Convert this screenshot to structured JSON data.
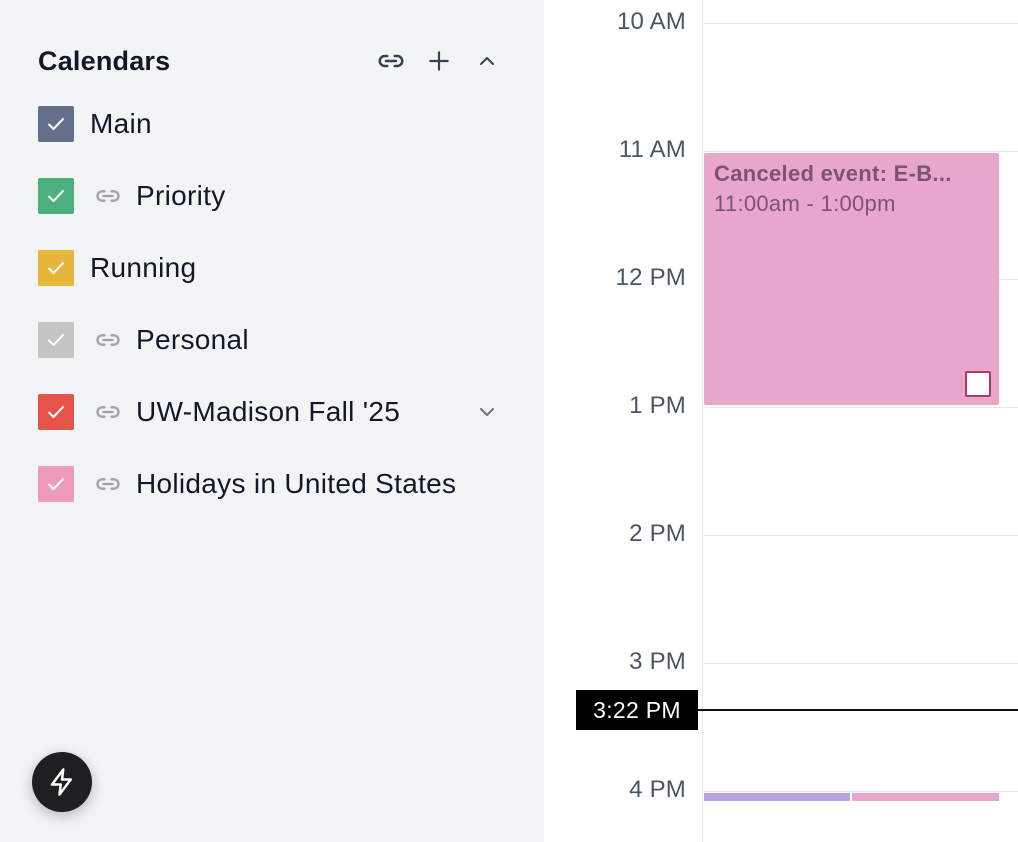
{
  "sidebar": {
    "title": "Calendars",
    "actions": [
      {
        "name": "link-calendar-button",
        "icon": "link-icon"
      },
      {
        "name": "add-calendar-button",
        "icon": "plus-icon"
      },
      {
        "name": "collapse-calendars-button",
        "icon": "chevron-up-icon"
      }
    ],
    "calendars": [
      {
        "label": "Main",
        "color": "#64708a",
        "checked": true,
        "linked": false,
        "expandable": false
      },
      {
        "label": "Priority",
        "color": "#4caf7d",
        "checked": true,
        "linked": true,
        "expandable": false
      },
      {
        "label": "Running",
        "color": "#e6b53a",
        "checked": true,
        "linked": false,
        "expandable": false
      },
      {
        "label": "Personal",
        "color": "#c4c4c4",
        "checked": true,
        "linked": true,
        "expandable": false
      },
      {
        "label": "UW-Madison Fall '25",
        "color": "#e5534b",
        "checked": true,
        "linked": true,
        "expandable": true
      },
      {
        "label": "Holidays in United States",
        "color": "#ee9ab8",
        "checked": true,
        "linked": true,
        "expandable": false
      }
    ],
    "fab_icon": "lightning-icon"
  },
  "grid": {
    "hours": [
      "10 AM",
      "11 AM",
      "12 PM",
      "1 PM",
      "2 PM",
      "3 PM",
      "4 PM"
    ],
    "current_time": "3:22 PM",
    "events": [
      {
        "title": "Canceled event: E-B...",
        "time": "11:00am - 1:00pm",
        "color": "#e9a6cb",
        "text_color": "#7a5470"
      }
    ],
    "bottom_event_colors": [
      "#b9a3dc",
      "#e9a6cb"
    ]
  }
}
